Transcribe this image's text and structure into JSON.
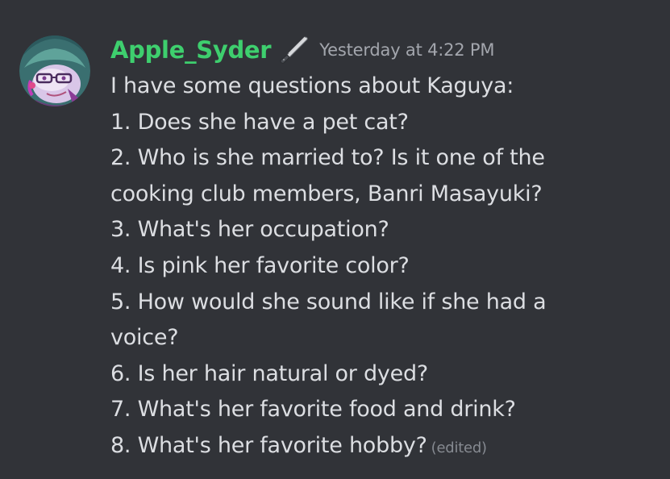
{
  "message": {
    "author": "Apple_Syder",
    "role_icon": "knife-icon",
    "timestamp": "Yesterday at 4:22 PM",
    "lines": [
      "I have some questions about Kaguya:",
      "1. Does she have a pet cat?",
      "2. Who is she married to? Is it one of the",
      "cooking club members, Banri Masayuki?",
      "3.  What's her occupation?",
      "4. Is pink her favorite color?",
      "5. How would she sound like if she had a",
      "voice?",
      "6. Is her hair natural or dyed?",
      "7. What's her favorite food and drink?",
      "8. What's her favorite hobby?"
    ],
    "edited_label": "(edited)"
  },
  "colors": {
    "background": "#313338",
    "username": "#3ecf6e",
    "text": "#dcdee2",
    "timestamp": "#a3a6ad",
    "edited": "#868a91"
  }
}
